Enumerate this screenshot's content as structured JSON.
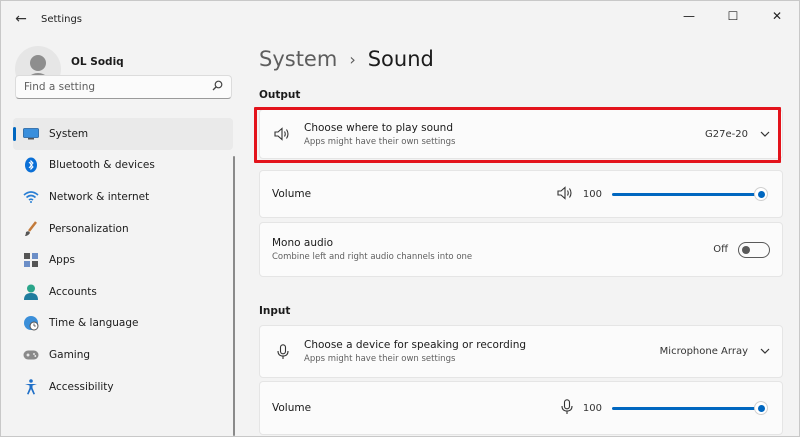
{
  "window": {
    "title": "Settings",
    "back_glyph": "←",
    "minimize_glyph": "—",
    "maximize_glyph": "☐",
    "close_glyph": "✕"
  },
  "profile": {
    "name": "OL Sodiq"
  },
  "search": {
    "placeholder": "Find a setting",
    "icon": "search-icon"
  },
  "nav": [
    {
      "label": "System",
      "icon": "monitor-icon",
      "active": true
    },
    {
      "label": "Bluetooth & devices",
      "icon": "bluetooth-icon"
    },
    {
      "label": "Network & internet",
      "icon": "wifi-icon"
    },
    {
      "label": "Personalization",
      "icon": "brush-icon"
    },
    {
      "label": "Apps",
      "icon": "apps-icon"
    },
    {
      "label": "Accounts",
      "icon": "person-icon"
    },
    {
      "label": "Time & language",
      "icon": "globe-icon"
    },
    {
      "label": "Gaming",
      "icon": "controller-icon"
    },
    {
      "label": "Accessibility",
      "icon": "accessibility-icon"
    }
  ],
  "breadcrumb": {
    "parent": "System",
    "separator": "›",
    "current": "Sound"
  },
  "output": {
    "section_title": "Output",
    "device": {
      "title": "Choose where to play sound",
      "subtitle": "Apps might have their own settings",
      "value": "G27e-20",
      "icon": "speaker-icon"
    },
    "volume": {
      "label": "Volume",
      "value": "100",
      "level": 1.0,
      "icon": "speaker-icon"
    },
    "mono": {
      "title": "Mono audio",
      "subtitle": "Combine left and right audio channels into one",
      "state": "Off"
    }
  },
  "input": {
    "section_title": "Input",
    "device": {
      "title": "Choose a device for speaking or recording",
      "subtitle": "Apps might have their own settings",
      "value": "Microphone Array",
      "icon": "microphone-icon"
    },
    "volume": {
      "label": "Volume",
      "value": "100",
      "level": 1.0,
      "icon": "microphone-icon"
    }
  },
  "colors": {
    "accent": "#0067c0",
    "highlight": "#e3131b"
  }
}
